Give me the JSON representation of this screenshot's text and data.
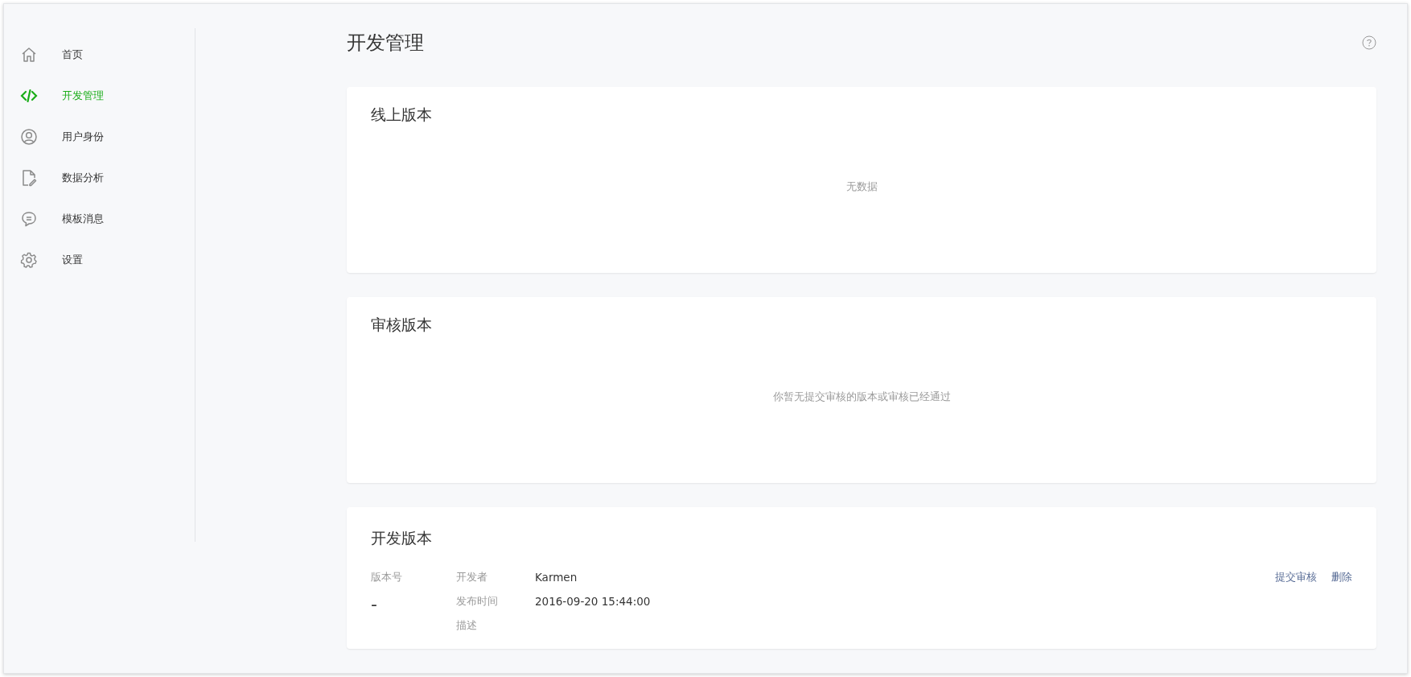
{
  "sidebar": {
    "items": [
      {
        "label": "首页",
        "selected": false
      },
      {
        "label": "开发管理",
        "selected": true
      },
      {
        "label": "用户身份",
        "selected": false
      },
      {
        "label": "数据分析",
        "selected": false
      },
      {
        "label": "模板消息",
        "selected": false
      },
      {
        "label": "设置",
        "selected": false
      }
    ]
  },
  "page_title": "开发管理",
  "sections": [
    {
      "title": "线上版本",
      "empty_text": "无数据"
    },
    {
      "title": "审核版本",
      "empty_text": "你暂无提交审核的版本或审核已经通过"
    }
  ],
  "dev_version": {
    "title": "开发版本",
    "version_label": "版本号",
    "version_value": "-",
    "fields": [
      {
        "label": "开发者",
        "value": "Karmen"
      },
      {
        "label": "发布时间",
        "value": "2016-09-20 15:44:00"
      },
      {
        "label": "描述"
      }
    ],
    "actions": [
      "提交审核",
      "删除"
    ]
  }
}
